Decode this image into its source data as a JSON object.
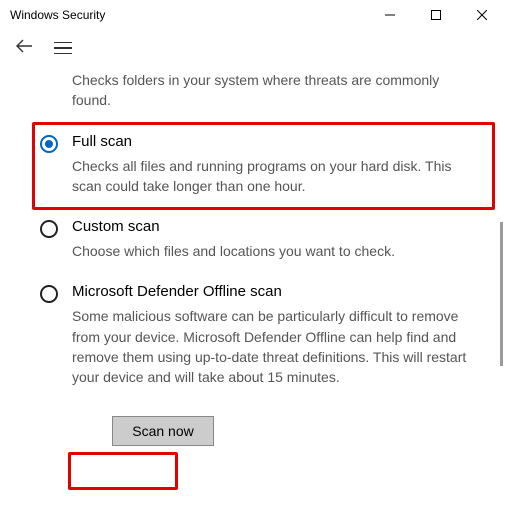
{
  "window": {
    "title": "Windows Security"
  },
  "intro": {
    "desc": "Checks folders in your system where threats are commonly found."
  },
  "options": {
    "full": {
      "title": "Full scan",
      "desc": "Checks all files and running programs on your hard disk. This scan could take longer than one hour.",
      "selected": true
    },
    "custom": {
      "title": "Custom scan",
      "desc": "Choose which files and locations you want to check.",
      "selected": false
    },
    "offline": {
      "title": "Microsoft Defender Offline scan",
      "desc": "Some malicious software can be particularly difficult to remove from your device. Microsoft Defender Offline can help find and remove them using up-to-date threat definitions. This will restart your device and will take about 15 minutes.",
      "selected": false
    }
  },
  "actions": {
    "scan": "Scan now"
  },
  "highlights": {
    "full_option": true,
    "scan_button": true
  },
  "colors": {
    "accent": "#0067c0",
    "highlight": "#e20000"
  }
}
